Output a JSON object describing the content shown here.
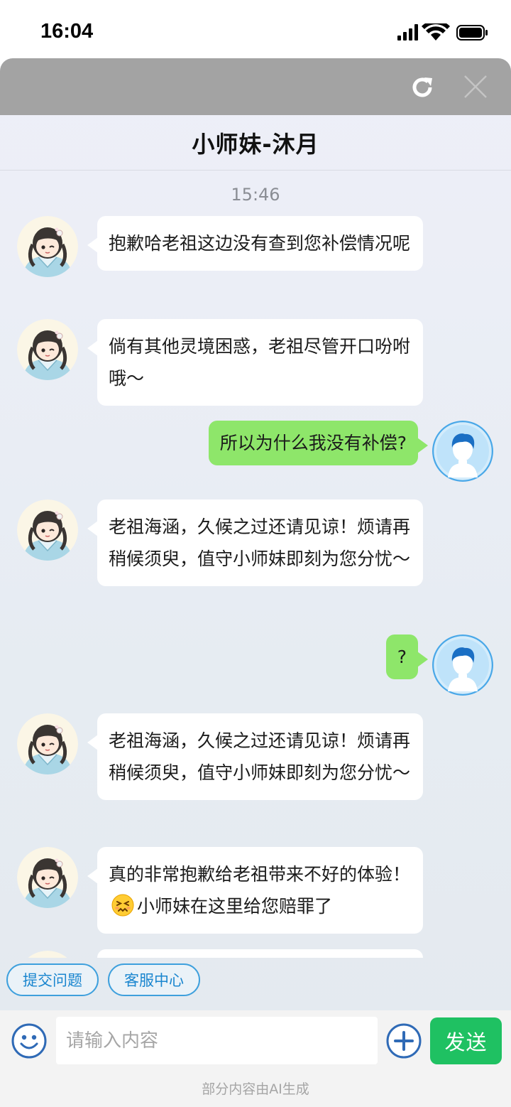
{
  "status_bar": {
    "time": "16:04"
  },
  "header": {
    "title": "小师妹-沐月"
  },
  "chat": {
    "timestamp": "15:46",
    "messages": [
      {
        "sender": "bot",
        "text": "抱歉哈老祖这边没有查到您补偿情况呢"
      },
      {
        "sender": "bot",
        "text": "倘有其他灵境困惑，老祖尽管开口吩咐哦～"
      },
      {
        "sender": "user",
        "text": "所以为什么我没有补偿?"
      },
      {
        "sender": "bot",
        "text": "老祖海涵，久候之过还请见谅！烦请再稍候须臾，值守小师妹即刻为您分忧～"
      },
      {
        "sender": "user",
        "text": "?"
      },
      {
        "sender": "bot",
        "text": "老祖海涵，久候之过还请见谅！烦请再稍候须臾，值守小师妹即刻为您分忧～"
      },
      {
        "sender": "bot",
        "text_before": "真的非常抱歉给老祖带来不好的体验！",
        "emoji": "persevering-face-emoji",
        "text_after": "小师妹在这里给您赔罪了"
      }
    ]
  },
  "quick_actions": [
    {
      "label": "提交问题"
    },
    {
      "label": "客服中心"
    }
  ],
  "input": {
    "placeholder": "请输入内容",
    "value": ""
  },
  "send_label": "发送",
  "footer_note": "部分内容由AI生成",
  "colors": {
    "user_bubble": "#8ee66a",
    "send_button": "#1fc162",
    "quick_action_border": "#3ea0dd",
    "topbar": "#a3a3a3"
  },
  "icons": {
    "refresh": "refresh-icon",
    "close": "close-icon",
    "emoji": "smiley-icon",
    "plus": "plus-circle-icon",
    "bot_avatar": "bot-avatar",
    "user_avatar": "user-avatar"
  }
}
